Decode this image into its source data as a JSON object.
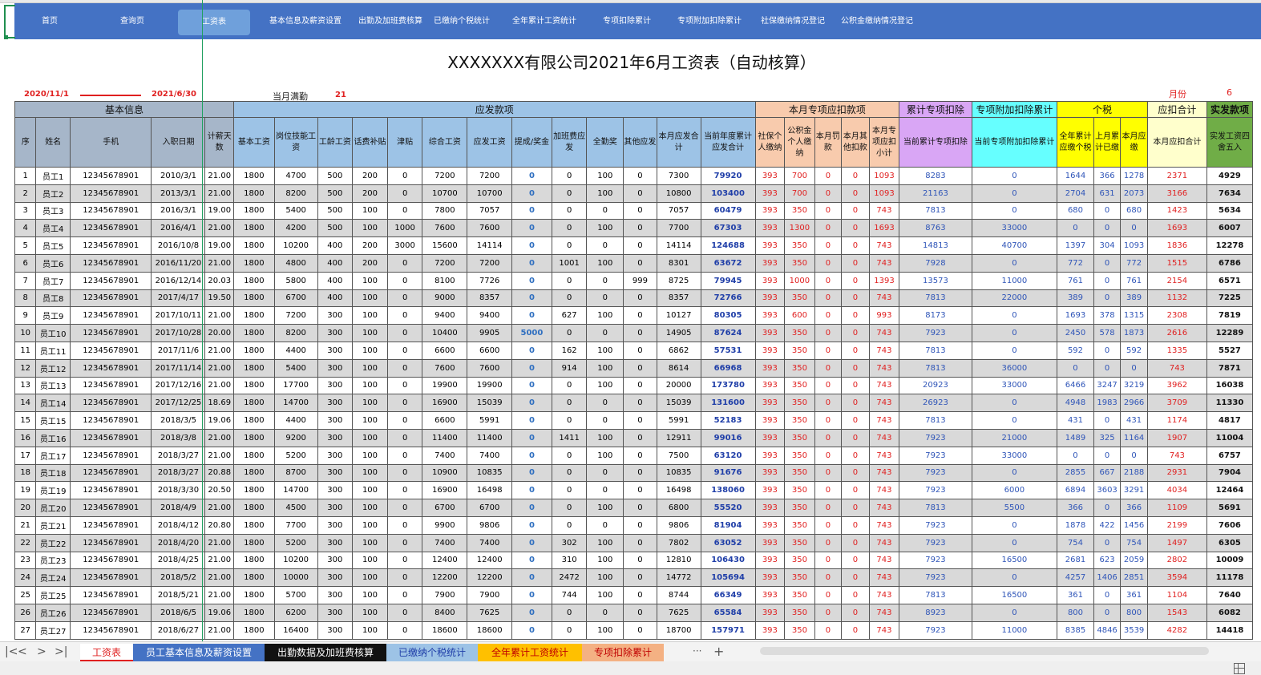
{
  "nav": {
    "items": [
      {
        "label": "首页"
      },
      {
        "label": "查询页"
      },
      {
        "label": "工资表",
        "active": true
      },
      {
        "label": "基本信息及薪资设置"
      },
      {
        "label": "出勤及加班费核算"
      },
      {
        "label": "已缴纳个税统计"
      },
      {
        "label": "全年累计工资统计"
      },
      {
        "label": "专项扣除累计"
      },
      {
        "label": "专项附加扣除累计"
      },
      {
        "label": "社保缴纳情况登记"
      },
      {
        "label": "公积金缴纳情况登记"
      }
    ]
  },
  "title": "XXXXXXX有限公司2021年6月工资表（自动核算）",
  "period": {
    "start": "2020/11/1",
    "end": "2021/6/30"
  },
  "full_attendance": {
    "label": "当月满勤",
    "value": "21"
  },
  "month": {
    "label": "月份",
    "value": "6"
  },
  "groups": {
    "basic": "基本信息",
    "payable": "应发款项",
    "deduct": "本月专项应扣款项",
    "cum_deduct": "累计专项扣除",
    "add_deduct": "专项附加扣除累计",
    "tax": "个税",
    "deduct_total": "应扣合计",
    "net": "实发款项"
  },
  "headers": [
    "序",
    "姓名",
    "手机",
    "入职日期",
    "计薪天数",
    "基本工资",
    "岗位技能工资",
    "工龄工资",
    "话费补贴",
    "津贴",
    "综合工资",
    "应发工资",
    "提成/奖金",
    "加班费应发",
    "全勤奖",
    "其他应发",
    "本月应发合计",
    "当前年度累计应发合计",
    "社保个人缴纳",
    "公积金个人缴纳",
    "本月罚款",
    "本月其他扣款",
    "本月专项应扣小计",
    "当前累计专项扣除",
    "当前专项附加扣除累计",
    "全年累计应缴个税",
    "上月累计已缴",
    "本月应缴",
    "本月应扣合计",
    "实发工资四舍五入"
  ],
  "rows": [
    [
      "1",
      "员工1",
      "12345678901",
      "2010/3/1",
      "21.00",
      "1800",
      "4700",
      "500",
      "200",
      "0",
      "7200",
      "7200",
      "0",
      "0",
      "100",
      "0",
      "7300",
      "79920",
      "393",
      "700",
      "0",
      "0",
      "1093",
      "8283",
      "0",
      "1644",
      "366",
      "1278",
      "2371",
      "4929"
    ],
    [
      "2",
      "员工2",
      "12345678901",
      "2013/3/1",
      "21.00",
      "1800",
      "8200",
      "500",
      "200",
      "0",
      "10700",
      "10700",
      "0",
      "0",
      "100",
      "0",
      "10800",
      "103400",
      "393",
      "700",
      "0",
      "0",
      "1093",
      "21163",
      "0",
      "2704",
      "631",
      "2073",
      "3166",
      "7634"
    ],
    [
      "3",
      "员工3",
      "12345678901",
      "2016/3/1",
      "19.00",
      "1800",
      "5400",
      "500",
      "100",
      "0",
      "7800",
      "7057",
      "0",
      "0",
      "0",
      "0",
      "7057",
      "60479",
      "393",
      "350",
      "0",
      "0",
      "743",
      "7813",
      "0",
      "680",
      "0",
      "680",
      "1423",
      "5634"
    ],
    [
      "4",
      "员工4",
      "12345678901",
      "2016/4/1",
      "21.00",
      "1800",
      "4200",
      "500",
      "100",
      "1000",
      "7600",
      "7600",
      "0",
      "0",
      "100",
      "0",
      "7700",
      "67303",
      "393",
      "1300",
      "0",
      "0",
      "1693",
      "8763",
      "33000",
      "0",
      "0",
      "0",
      "1693",
      "6007"
    ],
    [
      "5",
      "员工5",
      "12345678901",
      "2016/10/8",
      "19.00",
      "1800",
      "10200",
      "400",
      "200",
      "3000",
      "15600",
      "14114",
      "0",
      "0",
      "0",
      "0",
      "14114",
      "124688",
      "393",
      "350",
      "0",
      "0",
      "743",
      "14813",
      "40700",
      "1397",
      "304",
      "1093",
      "1836",
      "12278"
    ],
    [
      "6",
      "员工6",
      "12345678901",
      "2016/11/20",
      "21.00",
      "1800",
      "4800",
      "400",
      "200",
      "0",
      "7200",
      "7200",
      "0",
      "1001",
      "100",
      "0",
      "8301",
      "63672",
      "393",
      "350",
      "0",
      "0",
      "743",
      "7928",
      "0",
      "772",
      "0",
      "772",
      "1515",
      "6786"
    ],
    [
      "7",
      "员工7",
      "12345678901",
      "2016/12/14",
      "20.03",
      "1800",
      "5800",
      "400",
      "100",
      "0",
      "8100",
      "7726",
      "0",
      "0",
      "0",
      "999",
      "8725",
      "79945",
      "393",
      "1000",
      "0",
      "0",
      "1393",
      "13573",
      "11000",
      "761",
      "0",
      "761",
      "2154",
      "6571"
    ],
    [
      "8",
      "员工8",
      "12345678901",
      "2017/4/17",
      "19.50",
      "1800",
      "6700",
      "400",
      "100",
      "0",
      "9000",
      "8357",
      "0",
      "0",
      "0",
      "0",
      "8357",
      "72766",
      "393",
      "350",
      "0",
      "0",
      "743",
      "7813",
      "22000",
      "389",
      "0",
      "389",
      "1132",
      "7225"
    ],
    [
      "9",
      "员工9",
      "12345678901",
      "2017/10/11",
      "21.00",
      "1800",
      "7200",
      "300",
      "100",
      "0",
      "9400",
      "9400",
      "0",
      "627",
      "100",
      "0",
      "10127",
      "80305",
      "393",
      "600",
      "0",
      "0",
      "993",
      "8173",
      "0",
      "1693",
      "378",
      "1315",
      "2308",
      "7819"
    ],
    [
      "10",
      "员工10",
      "12345678901",
      "2017/10/28",
      "20.00",
      "1800",
      "8200",
      "300",
      "100",
      "0",
      "10400",
      "9905",
      "5000",
      "0",
      "0",
      "0",
      "14905",
      "87624",
      "393",
      "350",
      "0",
      "0",
      "743",
      "7923",
      "0",
      "2450",
      "578",
      "1873",
      "2616",
      "12289"
    ],
    [
      "11",
      "员工11",
      "12345678901",
      "2017/11/6",
      "21.00",
      "1800",
      "4400",
      "300",
      "100",
      "0",
      "6600",
      "6600",
      "0",
      "162",
      "100",
      "0",
      "6862",
      "57531",
      "393",
      "350",
      "0",
      "0",
      "743",
      "7813",
      "0",
      "592",
      "0",
      "592",
      "1335",
      "5527"
    ],
    [
      "12",
      "员工12",
      "12345678901",
      "2017/11/14",
      "21.00",
      "1800",
      "5400",
      "300",
      "100",
      "0",
      "7600",
      "7600",
      "0",
      "914",
      "100",
      "0",
      "8614",
      "66968",
      "393",
      "350",
      "0",
      "0",
      "743",
      "7813",
      "36000",
      "0",
      "0",
      "0",
      "743",
      "7871"
    ],
    [
      "13",
      "员工13",
      "12345678901",
      "2017/12/16",
      "21.00",
      "1800",
      "17700",
      "300",
      "100",
      "0",
      "19900",
      "19900",
      "0",
      "0",
      "100",
      "0",
      "20000",
      "173780",
      "393",
      "350",
      "0",
      "0",
      "743",
      "20923",
      "33000",
      "6466",
      "3247",
      "3219",
      "3962",
      "16038"
    ],
    [
      "14",
      "员工14",
      "12345678901",
      "2017/12/25",
      "18.69",
      "1800",
      "14700",
      "300",
      "100",
      "0",
      "16900",
      "15039",
      "0",
      "0",
      "0",
      "0",
      "15039",
      "131600",
      "393",
      "350",
      "0",
      "0",
      "743",
      "26923",
      "0",
      "4948",
      "1983",
      "2966",
      "3709",
      "11330"
    ],
    [
      "15",
      "员工15",
      "12345678901",
      "2018/3/5",
      "19.06",
      "1800",
      "4400",
      "300",
      "100",
      "0",
      "6600",
      "5991",
      "0",
      "0",
      "0",
      "0",
      "5991",
      "52183",
      "393",
      "350",
      "0",
      "0",
      "743",
      "7813",
      "0",
      "431",
      "0",
      "431",
      "1174",
      "4817"
    ],
    [
      "16",
      "员工16",
      "12345678901",
      "2018/3/8",
      "21.00",
      "1800",
      "9200",
      "300",
      "100",
      "0",
      "11400",
      "11400",
      "0",
      "1411",
      "100",
      "0",
      "12911",
      "99016",
      "393",
      "350",
      "0",
      "0",
      "743",
      "7923",
      "21000",
      "1489",
      "325",
      "1164",
      "1907",
      "11004"
    ],
    [
      "17",
      "员工17",
      "12345678901",
      "2018/3/27",
      "21.00",
      "1800",
      "5200",
      "300",
      "100",
      "0",
      "7400",
      "7400",
      "0",
      "0",
      "100",
      "0",
      "7500",
      "63120",
      "393",
      "350",
      "0",
      "0",
      "743",
      "7923",
      "33000",
      "0",
      "0",
      "0",
      "743",
      "6757"
    ],
    [
      "18",
      "员工18",
      "12345678901",
      "2018/3/27",
      "20.88",
      "1800",
      "8700",
      "300",
      "100",
      "0",
      "10900",
      "10835",
      "0",
      "0",
      "0",
      "0",
      "10835",
      "91676",
      "393",
      "350",
      "0",
      "0",
      "743",
      "7923",
      "0",
      "2855",
      "667",
      "2188",
      "2931",
      "7904"
    ],
    [
      "19",
      "员工19",
      "12345678901",
      "2018/3/30",
      "20.50",
      "1800",
      "14700",
      "300",
      "100",
      "0",
      "16900",
      "16498",
      "0",
      "0",
      "0",
      "0",
      "16498",
      "138060",
      "393",
      "350",
      "0",
      "0",
      "743",
      "7923",
      "6000",
      "6894",
      "3603",
      "3291",
      "4034",
      "12464"
    ],
    [
      "20",
      "员工20",
      "12345678901",
      "2018/4/9",
      "21.00",
      "1800",
      "4500",
      "300",
      "100",
      "0",
      "6700",
      "6700",
      "0",
      "0",
      "100",
      "0",
      "6800",
      "55520",
      "393",
      "350",
      "0",
      "0",
      "743",
      "7813",
      "5500",
      "366",
      "0",
      "366",
      "1109",
      "5691"
    ],
    [
      "21",
      "员工21",
      "12345678901",
      "2018/4/12",
      "20.80",
      "1800",
      "7700",
      "300",
      "100",
      "0",
      "9900",
      "9806",
      "0",
      "0",
      "0",
      "0",
      "9806",
      "81904",
      "393",
      "350",
      "0",
      "0",
      "743",
      "7923",
      "0",
      "1878",
      "422",
      "1456",
      "2199",
      "7606"
    ],
    [
      "22",
      "员工22",
      "12345678901",
      "2018/4/20",
      "21.00",
      "1800",
      "5200",
      "300",
      "100",
      "0",
      "7400",
      "7400",
      "0",
      "302",
      "100",
      "0",
      "7802",
      "63052",
      "393",
      "350",
      "0",
      "0",
      "743",
      "7923",
      "0",
      "754",
      "0",
      "754",
      "1497",
      "6305"
    ],
    [
      "23",
      "员工23",
      "12345678901",
      "2018/4/25",
      "21.00",
      "1800",
      "10200",
      "300",
      "100",
      "0",
      "12400",
      "12400",
      "0",
      "310",
      "100",
      "0",
      "12810",
      "106430",
      "393",
      "350",
      "0",
      "0",
      "743",
      "7923",
      "16500",
      "2681",
      "623",
      "2059",
      "2802",
      "10009"
    ],
    [
      "24",
      "员工24",
      "12345678901",
      "2018/5/2",
      "21.00",
      "1800",
      "10000",
      "300",
      "100",
      "0",
      "12200",
      "12200",
      "0",
      "2472",
      "100",
      "0",
      "14772",
      "105694",
      "393",
      "350",
      "0",
      "0",
      "743",
      "7923",
      "0",
      "4257",
      "1406",
      "2851",
      "3594",
      "11178"
    ],
    [
      "25",
      "员工25",
      "12345678901",
      "2018/5/21",
      "21.00",
      "1800",
      "5700",
      "300",
      "100",
      "0",
      "7900",
      "7900",
      "0",
      "744",
      "100",
      "0",
      "8744",
      "66349",
      "393",
      "350",
      "0",
      "0",
      "743",
      "7813",
      "16500",
      "361",
      "0",
      "361",
      "1104",
      "7640"
    ],
    [
      "26",
      "员工26",
      "12345678901",
      "2018/6/5",
      "19.06",
      "1800",
      "6200",
      "300",
      "100",
      "0",
      "8400",
      "7625",
      "0",
      "0",
      "0",
      "0",
      "7625",
      "65584",
      "393",
      "350",
      "0",
      "0",
      "743",
      "8923",
      "0",
      "800",
      "0",
      "800",
      "1543",
      "6082"
    ],
    [
      "27",
      "员工27",
      "12345678901",
      "2018/6/27",
      "21.00",
      "1800",
      "16400",
      "300",
      "100",
      "0",
      "18600",
      "18600",
      "0",
      "0",
      "100",
      "0",
      "18700",
      "157971",
      "393",
      "350",
      "0",
      "0",
      "743",
      "7923",
      "11000",
      "8385",
      "4846",
      "3539",
      "4282",
      "14418"
    ]
  ],
  "sheet_tabs": [
    {
      "label": "工资表",
      "active": true
    },
    {
      "label": "员工基本信息及薪资设置"
    },
    {
      "label": "出勤数据及加班费核算"
    },
    {
      "label": "已缴纳个税统计"
    },
    {
      "label": "全年累计工资统计"
    },
    {
      "label": "专项扣除累计"
    }
  ],
  "tab_nav": {
    "first": "|<",
    "prev": "<",
    "next": ">",
    "last": ">|",
    "more": "···",
    "add": "+"
  },
  "colors": {
    "nav": "#4472c4",
    "accent_red": "#e02020",
    "frozen_line": "#20a060"
  }
}
